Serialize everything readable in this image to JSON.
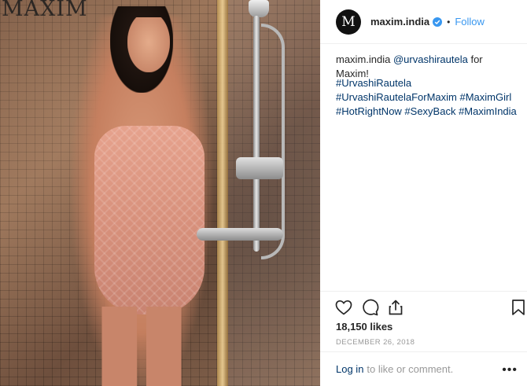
{
  "photo": {
    "brand_text": "MAXIM"
  },
  "post": {
    "avatar_letter": "M",
    "username": "maxim.india",
    "separator": "•",
    "follow_label": "Follow",
    "caption_user": "maxim.india",
    "caption_mention": "@urvashirautela",
    "caption_text": "for Maxim!",
    "hashtags": "#UrvashiRautela #UrvashiRautelaForMaxim #MaximGirl #HotRightNow #SexyBack #MaximIndia",
    "likes": "18,150 likes",
    "date": "DECEMBER 26, 2018",
    "login_link": "Log in",
    "login_rest": "to like or comment.",
    "more_glyph": "•••"
  },
  "icons": [
    "heart-icon",
    "comment-icon",
    "share-icon",
    "bookmark-icon",
    "verified-icon",
    "more-options-icon"
  ],
  "colors": {
    "link": "#003569",
    "follow": "#3897f0",
    "verified": "#3897f0",
    "muted": "#999999"
  }
}
